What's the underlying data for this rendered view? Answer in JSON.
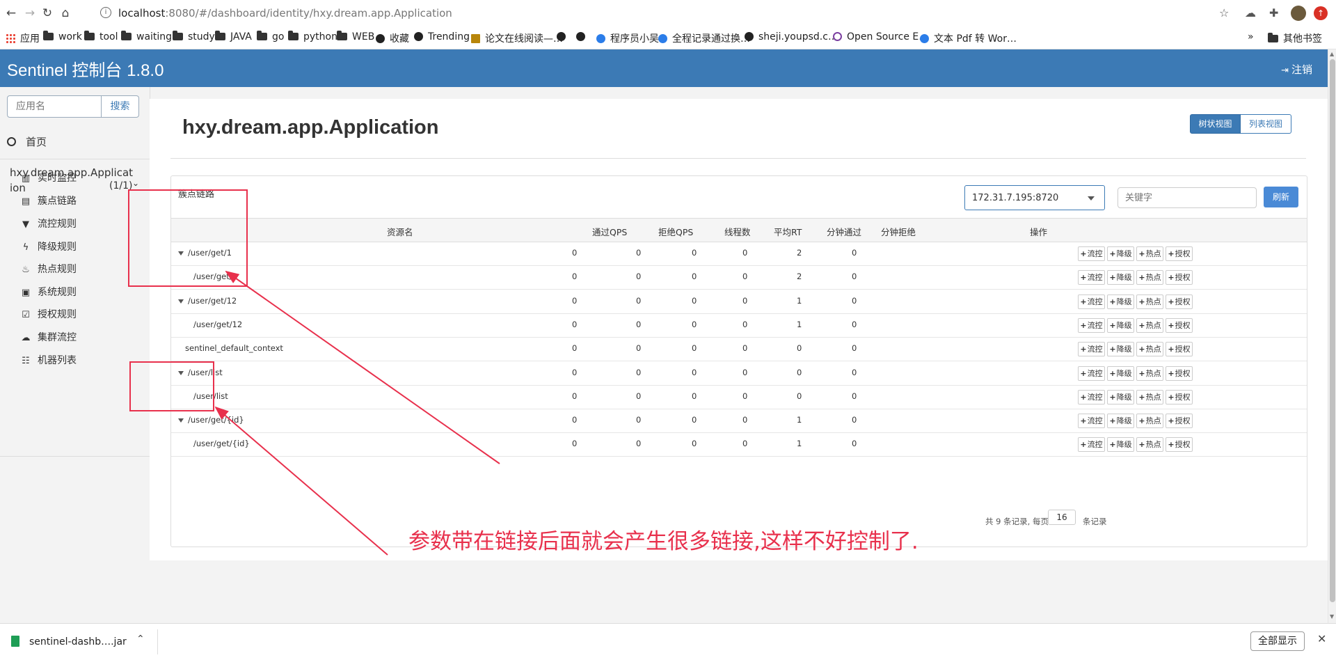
{
  "browser": {
    "url_host": "localhost",
    "url_rest": ":8080/#/dashboard/identity/hxy.dream.app.Application",
    "bookmarks": [
      {
        "label": "应用",
        "icon": "apps-icon"
      },
      {
        "label": "work",
        "icon": "folder-icon"
      },
      {
        "label": "tool",
        "icon": "folder-icon"
      },
      {
        "label": "waiting",
        "icon": "folder-icon"
      },
      {
        "label": "study",
        "icon": "folder-icon"
      },
      {
        "label": "JAVA",
        "icon": "folder-icon"
      },
      {
        "label": "go",
        "icon": "folder-icon"
      },
      {
        "label": "python",
        "icon": "folder-icon"
      },
      {
        "label": "WEB",
        "icon": "folder-icon"
      },
      {
        "label": "收藏",
        "icon": "globe-icon"
      },
      {
        "label": "Trending",
        "icon": "github-icon"
      },
      {
        "label": "论文在线阅读—…",
        "icon": "page-icon"
      },
      {
        "label": "",
        "icon": "globe-icon"
      },
      {
        "label": "",
        "icon": "globe-icon"
      },
      {
        "label": "程序员小吴",
        "icon": "shield-icon"
      },
      {
        "label": "全程记录通过换…",
        "icon": "swirl-icon"
      },
      {
        "label": "sheji.youpsd.c…",
        "icon": "globe-icon"
      },
      {
        "label": "Open Source E…",
        "icon": "circle-icon"
      },
      {
        "label": "文本 Pdf 转 Wor…",
        "icon": "swirl-icon"
      }
    ],
    "bookmarks_overflow": "»",
    "other_bookmarks": "其他书签"
  },
  "header": {
    "title": "Sentinel 控制台 1.8.0",
    "logout_label": "注销"
  },
  "sidebar": {
    "search_placeholder": "应用名",
    "search_button": "搜索",
    "home_label": "首页",
    "app_name": "hxy.dream.app.Application",
    "app_count": "(1/1)",
    "menu": [
      {
        "label": "实时监控",
        "icon": "bar-chart-icon"
      },
      {
        "label": "簇点链路",
        "icon": "list-icon"
      },
      {
        "label": "流控规则",
        "icon": "filter-icon"
      },
      {
        "label": "降级规则",
        "icon": "flash-icon"
      },
      {
        "label": "热点规则",
        "icon": "fire-icon"
      },
      {
        "label": "系统规则",
        "icon": "lock-icon"
      },
      {
        "label": "授权规则",
        "icon": "check-icon"
      },
      {
        "label": "集群流控",
        "icon": "cloud-icon"
      },
      {
        "label": "机器列表",
        "icon": "th-list-icon"
      }
    ]
  },
  "main": {
    "page_title": "hxy.dream.app.Application",
    "view_tree": "树状视图",
    "view_list": "列表视图",
    "panel_label": "簇点链路",
    "machine": "172.31.7.195:8720",
    "keyword_placeholder": "关键字",
    "refresh": "刷新",
    "columns": [
      "资源名",
      "通过QPS",
      "拒绝QPS",
      "线程数",
      "平均RT",
      "分钟通过",
      "分钟拒绝",
      "操作"
    ],
    "op_labels": [
      "流控",
      "降级",
      "热点",
      "授权"
    ],
    "rows": [
      {
        "resource": "/user/get/1",
        "level": 0,
        "expand": true,
        "pass_qps": "0",
        "block_qps": "0",
        "threads": "0",
        "avg_rt": "0",
        "min_pass": "2",
        "min_block": "0"
      },
      {
        "resource": "/user/get/1",
        "level": 1,
        "expand": false,
        "pass_qps": "0",
        "block_qps": "0",
        "threads": "0",
        "avg_rt": "0",
        "min_pass": "2",
        "min_block": "0"
      },
      {
        "resource": "/user/get/12",
        "level": 0,
        "expand": true,
        "pass_qps": "0",
        "block_qps": "0",
        "threads": "0",
        "avg_rt": "0",
        "min_pass": "1",
        "min_block": "0"
      },
      {
        "resource": "/user/get/12",
        "level": 1,
        "expand": false,
        "pass_qps": "0",
        "block_qps": "0",
        "threads": "0",
        "avg_rt": "0",
        "min_pass": "1",
        "min_block": "0"
      },
      {
        "resource": "sentinel_default_context",
        "level": 0,
        "expand": false,
        "pass_qps": "0",
        "block_qps": "0",
        "threads": "0",
        "avg_rt": "0",
        "min_pass": "0",
        "min_block": "0"
      },
      {
        "resource": "/user/list",
        "level": 0,
        "expand": true,
        "pass_qps": "0",
        "block_qps": "0",
        "threads": "0",
        "avg_rt": "0",
        "min_pass": "0",
        "min_block": "0"
      },
      {
        "resource": "/user/list",
        "level": 1,
        "expand": false,
        "pass_qps": "0",
        "block_qps": "0",
        "threads": "0",
        "avg_rt": "0",
        "min_pass": "0",
        "min_block": "0"
      },
      {
        "resource": "/user/get/{id}",
        "level": 0,
        "expand": true,
        "pass_qps": "0",
        "block_qps": "0",
        "threads": "0",
        "avg_rt": "0",
        "min_pass": "1",
        "min_block": "0"
      },
      {
        "resource": "/user/get/{id}",
        "level": 1,
        "expand": false,
        "pass_qps": "0",
        "block_qps": "0",
        "threads": "0",
        "avg_rt": "0",
        "min_pass": "1",
        "min_block": "0"
      }
    ],
    "pager_prefix": "共 9 条记录, 每页",
    "page_size": "16",
    "pager_suffix": "条记录"
  },
  "annotation": {
    "text": "参数带在链接后面就会产生很多链接,这样不好控制了.",
    "color": "#e8304c"
  },
  "download_bar": {
    "file_name": "sentinel-dashb….jar",
    "show_all": "全部显示"
  },
  "colors": {
    "header": "#3c7ab5",
    "primary": "#3c7ab5",
    "refresh": "#4a8ad6"
  }
}
